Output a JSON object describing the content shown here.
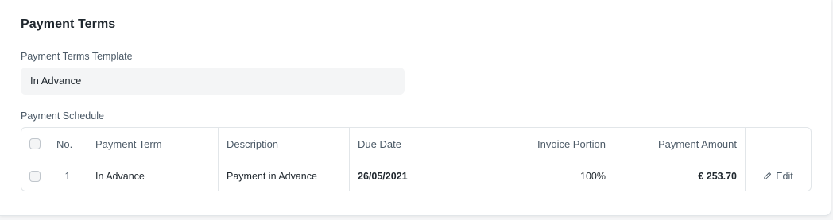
{
  "section": {
    "title": "Payment Terms"
  },
  "template_field": {
    "label": "Payment Terms Template",
    "value": "In Advance"
  },
  "schedule": {
    "label": "Payment Schedule",
    "columns": {
      "no": "No.",
      "payment_term": "Payment Term",
      "description": "Description",
      "due_date": "Due Date",
      "invoice_portion": "Invoice Portion",
      "payment_amount": "Payment Amount"
    },
    "rows": [
      {
        "no": "1",
        "payment_term": "In Advance",
        "description": "Payment in Advance",
        "due_date": "26/05/2021",
        "invoice_portion": "100%",
        "payment_amount": "€ 253.70",
        "action": "Edit",
        "action_icon": "pencil-icon"
      }
    ]
  }
}
